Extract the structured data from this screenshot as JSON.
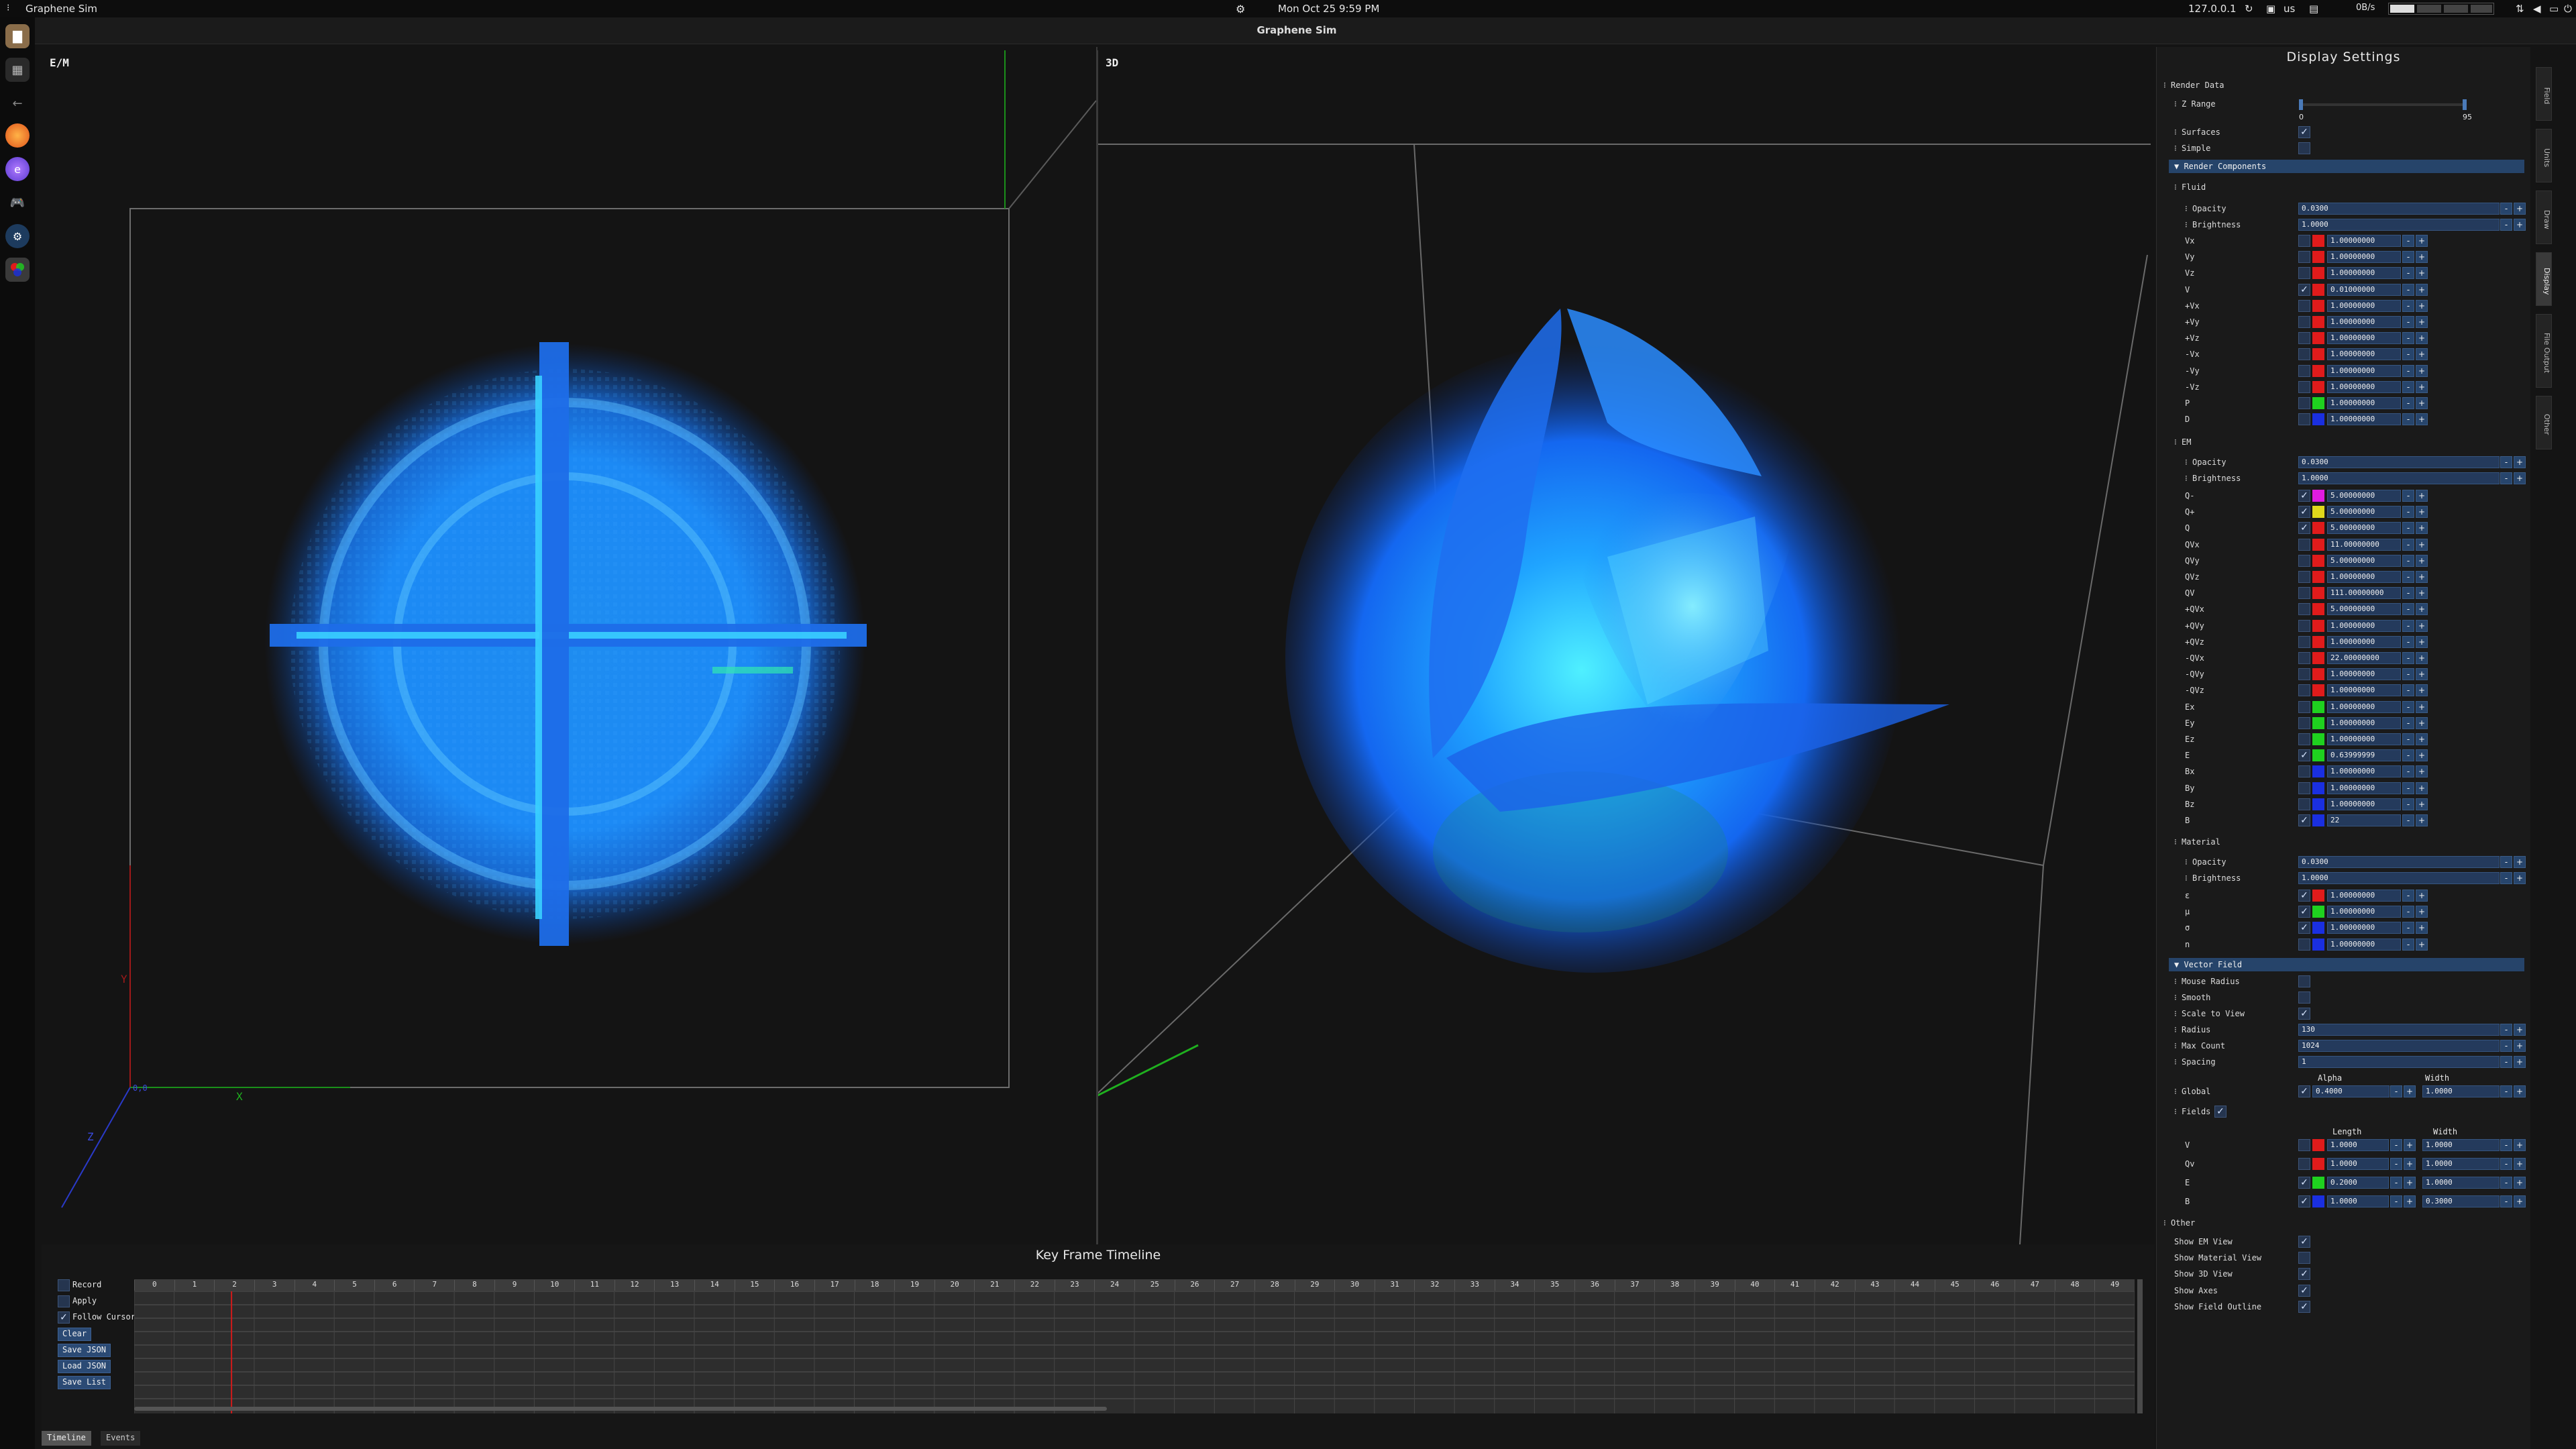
{
  "topbar": {
    "app_name": "Graphene Sim",
    "clock": "Mon Oct 25  9:59 PM",
    "ip": "127.0.0.1",
    "kb_layout": "us",
    "net_rate": "0B/s"
  },
  "window": {
    "title": "Graphene Sim"
  },
  "dock_icons": [
    "files-icon",
    "layout-icon",
    "back-icon",
    "firefox-icon",
    "browser-icon",
    "game-icon",
    "steam-icon",
    "graphene-icon"
  ],
  "em_view": {
    "label": "E/M",
    "axis_x": "X",
    "axis_y": "Y",
    "axis_z": "Z",
    "axis_origin": "0,0"
  },
  "view3d": {
    "label": "3D"
  },
  "colors": {
    "accent": "#26446a",
    "red": "#e01b1b",
    "green": "#1fd11f",
    "blue": "#1a2fe0",
    "magenta": "#e01be0",
    "yellow": "#e0d81b"
  },
  "panel": {
    "title": "Display Settings",
    "render_data": {
      "label": "Render Data",
      "z_range_label": "Z Range",
      "z_range_min": "0",
      "z_range_max": "95",
      "surfaces_label": "Surfaces",
      "simple_label": "Simple"
    },
    "render_components": {
      "label": "Render Components",
      "fluid": {
        "label": "Fluid",
        "opacity_label": "Opacity",
        "opacity": "0.0300",
        "brightness_label": "Brightness",
        "brightness": "1.0000",
        "rows": [
          {
            "name": "Vx",
            "checked": false,
            "color": "#e01b1b",
            "value": "1.00000000"
          },
          {
            "name": "Vy",
            "checked": false,
            "color": "#e01b1b",
            "value": "1.00000000"
          },
          {
            "name": "Vz",
            "checked": false,
            "color": "#e01b1b",
            "value": "1.00000000"
          },
          {
            "name": "V",
            "checked": true,
            "color": "#e01b1b",
            "value": "0.01000000"
          },
          {
            "name": "+Vx",
            "checked": false,
            "color": "#e01b1b",
            "value": "1.00000000"
          },
          {
            "name": "+Vy",
            "checked": false,
            "color": "#e01b1b",
            "value": "1.00000000"
          },
          {
            "name": "+Vz",
            "checked": false,
            "color": "#e01b1b",
            "value": "1.00000000"
          },
          {
            "name": "-Vx",
            "checked": false,
            "color": "#e01b1b",
            "value": "1.00000000"
          },
          {
            "name": "-Vy",
            "checked": false,
            "color": "#e01b1b",
            "value": "1.00000000"
          },
          {
            "name": "-Vz",
            "checked": false,
            "color": "#e01b1b",
            "value": "1.00000000"
          },
          {
            "name": "P",
            "checked": false,
            "color": "#1fd11f",
            "value": "1.00000000"
          },
          {
            "name": "D",
            "checked": false,
            "color": "#1a2fe0",
            "value": "1.00000000"
          }
        ]
      },
      "em": {
        "label": "EM",
        "opacity_label": "Opacity",
        "opacity": "0.0300",
        "brightness_label": "Brightness",
        "brightness": "1.0000",
        "rows": [
          {
            "name": "Q-",
            "checked": true,
            "color": "#e01be0",
            "value": "5.00000000"
          },
          {
            "name": "Q+",
            "checked": true,
            "color": "#e0d81b",
            "value": "5.00000000"
          },
          {
            "name": "Q",
            "checked": true,
            "color": "#e01b1b",
            "value": "5.00000000"
          },
          {
            "name": "QVx",
            "checked": false,
            "color": "#e01b1b",
            "value": "11.00000000"
          },
          {
            "name": "QVy",
            "checked": false,
            "color": "#e01b1b",
            "value": "5.00000000"
          },
          {
            "name": "QVz",
            "checked": false,
            "color": "#e01b1b",
            "value": "1.00000000"
          },
          {
            "name": "QV",
            "checked": false,
            "color": "#e01b1b",
            "value": "111.00000000"
          },
          {
            "name": "+QVx",
            "checked": false,
            "color": "#e01b1b",
            "value": "5.00000000"
          },
          {
            "name": "+QVy",
            "checked": false,
            "color": "#e01b1b",
            "value": "1.00000000"
          },
          {
            "name": "+QVz",
            "checked": false,
            "color": "#e01b1b",
            "value": "1.00000000"
          },
          {
            "name": "-QVx",
            "checked": false,
            "color": "#e01b1b",
            "value": "22.00000000"
          },
          {
            "name": "-QVy",
            "checked": false,
            "color": "#e01b1b",
            "value": "1.00000000"
          },
          {
            "name": "-QVz",
            "checked": false,
            "color": "#e01b1b",
            "value": "1.00000000"
          },
          {
            "name": "Ex",
            "checked": false,
            "color": "#1fd11f",
            "value": "1.00000000"
          },
          {
            "name": "Ey",
            "checked": false,
            "color": "#1fd11f",
            "value": "1.00000000"
          },
          {
            "name": "Ez",
            "checked": false,
            "color": "#1fd11f",
            "value": "1.00000000"
          },
          {
            "name": "E",
            "checked": true,
            "color": "#1fd11f",
            "value": "0.63999999"
          },
          {
            "name": "Bx",
            "checked": false,
            "color": "#1a2fe0",
            "value": "1.00000000"
          },
          {
            "name": "By",
            "checked": false,
            "color": "#1a2fe0",
            "value": "1.00000000"
          },
          {
            "name": "Bz",
            "checked": false,
            "color": "#1a2fe0",
            "value": "1.00000000"
          },
          {
            "name": "B",
            "checked": true,
            "color": "#1a2fe0",
            "value": "22"
          }
        ]
      },
      "material": {
        "label": "Material",
        "opacity_label": "Opacity",
        "opacity": "0.0300",
        "brightness_label": "Brightness",
        "brightness": "1.0000",
        "rows": [
          {
            "name": "ε",
            "checked": true,
            "color": "#e01b1b",
            "value": "1.00000000"
          },
          {
            "name": "μ",
            "checked": true,
            "color": "#1fd11f",
            "value": "1.00000000"
          },
          {
            "name": "σ",
            "checked": true,
            "color": "#1a2fe0",
            "value": "1.00000000"
          },
          {
            "name": "n",
            "checked": false,
            "color": "#1a2fe0",
            "value": "1.00000000"
          }
        ]
      }
    },
    "vector_field": {
      "label": "Vector Field",
      "mouse_radius_label": "Mouse Radius",
      "smooth_label": "Smooth",
      "scale_to_view_label": "Scale to View",
      "radius_label": "Radius",
      "radius": "130",
      "max_count_label": "Max Count",
      "max_count": "1024",
      "spacing_label": "Spacing",
      "spacing": "1",
      "alpha_header": "Alpha",
      "width_header": "Width",
      "global_label": "Global",
      "global_alpha": "0.4000",
      "global_width": "1.0000",
      "fields_label": "Fields",
      "length_header": "Length",
      "rows": [
        {
          "name": "V",
          "checked": false,
          "color": "#e01b1b",
          "length": "1.0000",
          "width": "1.0000"
        },
        {
          "name": "Qv",
          "checked": false,
          "color": "#e01b1b",
          "length": "1.0000",
          "width": "1.0000"
        },
        {
          "name": "E",
          "checked": true,
          "color": "#1fd11f",
          "length": "0.2000",
          "width": "1.0000"
        },
        {
          "name": "B",
          "checked": true,
          "color": "#1a2fe0",
          "length": "1.0000",
          "width": "0.3000"
        }
      ]
    },
    "other": {
      "label": "Other",
      "items": [
        {
          "label": "Show EM View",
          "checked": true
        },
        {
          "label": "Show Material View",
          "checked": false
        },
        {
          "label": "Show 3D View",
          "checked": true
        },
        {
          "label": "Show Axes",
          "checked": true
        },
        {
          "label": "Show Field Outline",
          "checked": true
        }
      ]
    },
    "side_tabs": [
      "Field",
      "Units",
      "Draw",
      "Display",
      "File Output",
      "Other"
    ]
  },
  "timeline": {
    "title": "Key Frame Timeline",
    "record_label": "Record",
    "apply_label": "Apply",
    "follow_cursor_label": "Follow Cursor",
    "clear_label": "Clear",
    "save_json_label": "Save JSON",
    "load_json_label": "Load JSON",
    "save_list_label": "Save List",
    "frames": [
      "0",
      "1",
      "2",
      "3",
      "4",
      "5",
      "6",
      "7",
      "8",
      "9",
      "10",
      "11",
      "12",
      "13",
      "14",
      "15",
      "16",
      "17",
      "18",
      "19",
      "20",
      "21",
      "22",
      "23",
      "24",
      "25",
      "26",
      "27",
      "28",
      "29",
      "30",
      "31",
      "32",
      "33",
      "34",
      "35",
      "36",
      "37",
      "38",
      "39",
      "40",
      "41",
      "42",
      "43",
      "44",
      "45",
      "46",
      "47",
      "48",
      "49"
    ],
    "cursor_frame": 2,
    "tabs": [
      "Timeline",
      "Events"
    ]
  }
}
